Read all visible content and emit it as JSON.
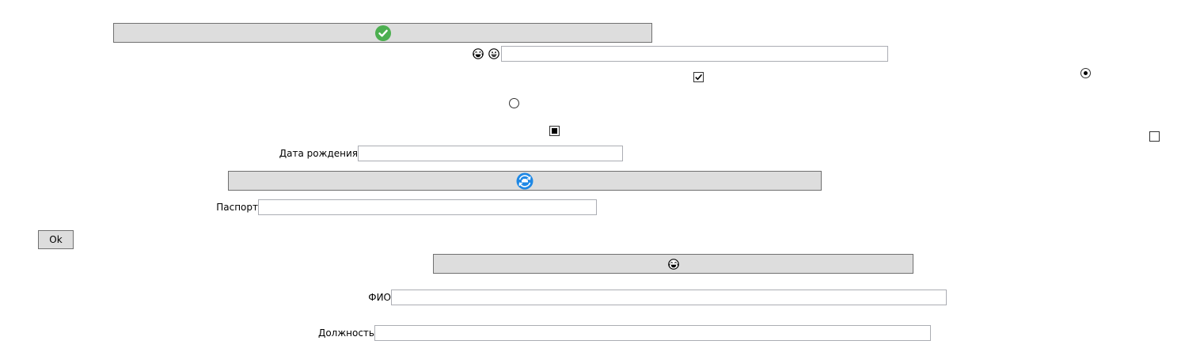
{
  "colors": {
    "button_bg": "#dddddd",
    "button_border": "#707070",
    "field_border": "#abadb3",
    "check_green": "#4caf50",
    "refresh_blue": "#1e88e5"
  },
  "top_button": {
    "icon": "check-circle-icon"
  },
  "emoji_row": {
    "icons": [
      "grinning-tears-icon",
      "grinning-face-icon"
    ],
    "value": ""
  },
  "checkboxes": {
    "checked": true,
    "indeterminate": "indeterminate",
    "unchecked": false
  },
  "radios": {
    "selected": true,
    "unselected": false
  },
  "birth_date": {
    "label": "Дата рождения",
    "value": ""
  },
  "middle_button": {
    "icon": "refresh-ship-icon"
  },
  "passport": {
    "label": "Паспорт",
    "value": ""
  },
  "ok_button": {
    "label": "Ok"
  },
  "emoji_button": {
    "icon": "grinning-tears-icon"
  },
  "full_name": {
    "label": "ФИО",
    "value": ""
  },
  "position": {
    "label": "Должность",
    "value": ""
  }
}
